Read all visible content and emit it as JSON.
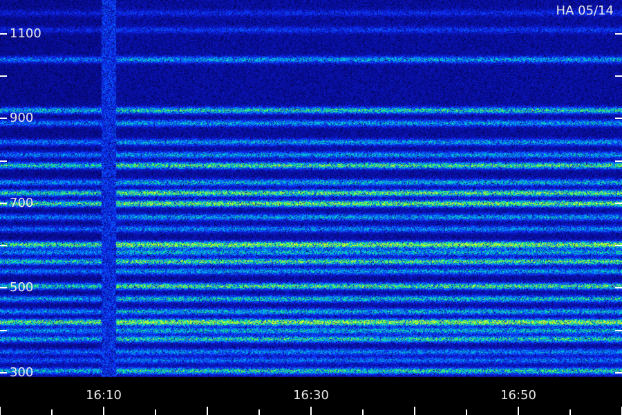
{
  "chart_data": {
    "type": "heatmap",
    "title": "HA 05/14",
    "xlabel": "",
    "ylabel": "",
    "x_ticks": [
      "16:10",
      "16:30",
      "16:50"
    ],
    "y_ticks": [
      "300",
      "500",
      "700",
      "900",
      "1100"
    ],
    "x_range": [
      "16:00",
      "17:00"
    ],
    "y_range": [
      290,
      1180
    ],
    "data_gap": {
      "start": "16:10",
      "end": "16:11"
    },
    "bands": [
      {
        "y": 305,
        "intensity": 0.55
      },
      {
        "y": 330,
        "intensity": 0.3
      },
      {
        "y": 350,
        "intensity": 0.35
      },
      {
        "y": 380,
        "intensity": 0.55
      },
      {
        "y": 400,
        "intensity": 0.45
      },
      {
        "y": 420,
        "intensity": 0.85
      },
      {
        "y": 445,
        "intensity": 0.45
      },
      {
        "y": 475,
        "intensity": 0.5
      },
      {
        "y": 505,
        "intensity": 0.65
      },
      {
        "y": 540,
        "intensity": 0.4
      },
      {
        "y": 563,
        "intensity": 0.65
      },
      {
        "y": 585,
        "intensity": 0.45
      },
      {
        "y": 603,
        "intensity": 0.8
      },
      {
        "y": 640,
        "intensity": 0.35
      },
      {
        "y": 668,
        "intensity": 0.4
      },
      {
        "y": 700,
        "intensity": 0.75
      },
      {
        "y": 725,
        "intensity": 0.7
      },
      {
        "y": 750,
        "intensity": 0.45
      },
      {
        "y": 790,
        "intensity": 0.65
      },
      {
        "y": 815,
        "intensity": 0.4
      },
      {
        "y": 845,
        "intensity": 0.4
      },
      {
        "y": 890,
        "intensity": 0.4
      },
      {
        "y": 920,
        "intensity": 0.55
      },
      {
        "y": 1040,
        "intensity": 0.4
      },
      {
        "y": 1110,
        "intensity": 0.18
      },
      {
        "y": 1150,
        "intensity": 0.15
      }
    ],
    "colorscale": [
      "#000033",
      "#0a10b0",
      "#1030ff",
      "#0090ff",
      "#00e0c0",
      "#40ff40",
      "#e0ff20"
    ],
    "grid": false,
    "legend": "none"
  }
}
